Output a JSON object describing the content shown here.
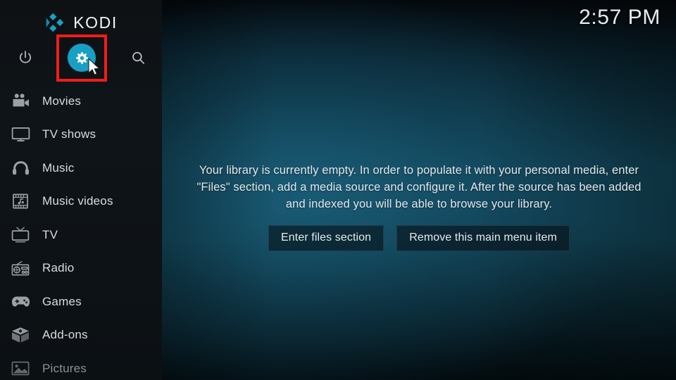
{
  "app": {
    "name": "KODI",
    "logo_icon": "kodi-logo-icon",
    "accent_color": "#1a9fc4",
    "highlight_color": "#f41b18"
  },
  "header": {
    "clock": "2:57 PM"
  },
  "sidebar": {
    "top_actions": [
      {
        "id": "power",
        "icon": "power-icon",
        "label": "Power"
      },
      {
        "id": "settings",
        "icon": "gear-icon",
        "label": "Settings",
        "highlighted": true,
        "active": true
      },
      {
        "id": "search",
        "icon": "search-icon",
        "label": "Search"
      }
    ],
    "items": [
      {
        "label": "Movies",
        "icon": "movie-camera-icon",
        "dim": false
      },
      {
        "label": "TV shows",
        "icon": "monitor-icon",
        "dim": false
      },
      {
        "label": "Music",
        "icon": "headphones-icon",
        "dim": false
      },
      {
        "label": "Music videos",
        "icon": "film-music-icon",
        "dim": false
      },
      {
        "label": "TV",
        "icon": "retro-tv-icon",
        "dim": false
      },
      {
        "label": "Radio",
        "icon": "radio-icon",
        "dim": false
      },
      {
        "label": "Games",
        "icon": "gamepad-icon",
        "dim": false
      },
      {
        "label": "Add-ons",
        "icon": "open-box-icon",
        "dim": false
      },
      {
        "label": "Pictures",
        "icon": "picture-icon",
        "dim": true
      }
    ]
  },
  "main": {
    "empty_message": "Your library is currently empty. In order to populate it with your personal media, enter \"Files\" section, add a media source and configure it. After the source has been added and indexed you will be able to browse your library.",
    "buttons": [
      {
        "label": "Enter files section"
      },
      {
        "label": "Remove this main menu item"
      }
    ]
  }
}
